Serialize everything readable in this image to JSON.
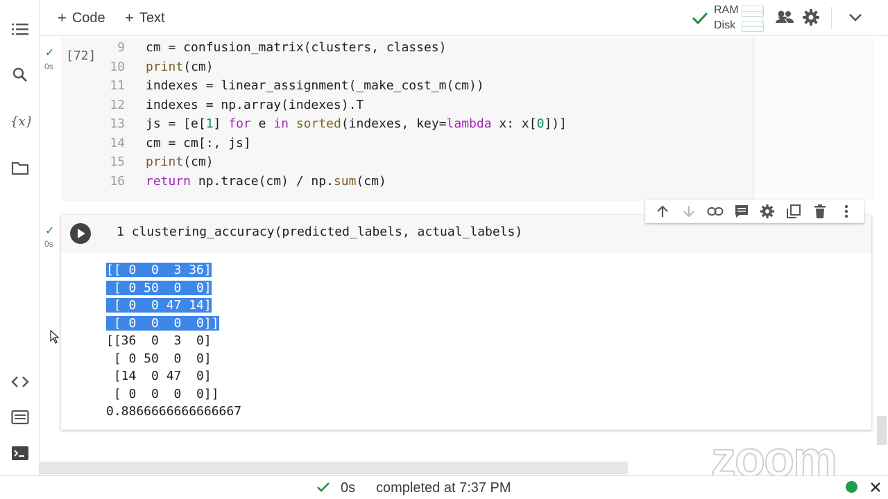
{
  "toolbar": {
    "code_label": "Code",
    "text_label": "Text",
    "ram_label": "RAM",
    "disk_label": "Disk"
  },
  "sidebar_icons": [
    "toc-icon",
    "search-icon",
    "variables-icon",
    "folder-icon",
    "code-snippets-icon",
    "command-palette-icon",
    "terminal-icon"
  ],
  "cell1": {
    "execution_count": "[72]",
    "run_time": "0s",
    "lines": [
      {
        "n": "9",
        "segments": [
          {
            "t": "cm = confusion_matrix(clusters, classes)",
            "c": ""
          }
        ]
      },
      {
        "n": "10",
        "segments": [
          {
            "t": "print",
            "c": "fn"
          },
          {
            "t": "(cm)",
            "c": ""
          }
        ]
      },
      {
        "n": "11",
        "segments": [
          {
            "t": "indexes = linear_assignment(_make_cost_m(cm))",
            "c": ""
          }
        ]
      },
      {
        "n": "12",
        "segments": [
          {
            "t": "indexes = np.array(indexes).T",
            "c": ""
          }
        ]
      },
      {
        "n": "13",
        "segments": [
          {
            "t": "js = [e[",
            "c": ""
          },
          {
            "t": "1",
            "c": "num"
          },
          {
            "t": "] ",
            "c": ""
          },
          {
            "t": "for",
            "c": "kw"
          },
          {
            "t": " e ",
            "c": ""
          },
          {
            "t": "in",
            "c": "kw"
          },
          {
            "t": " ",
            "c": ""
          },
          {
            "t": "sorted",
            "c": "fn"
          },
          {
            "t": "(indexes, key=",
            "c": ""
          },
          {
            "t": "lambda",
            "c": "kw"
          },
          {
            "t": " x: x[",
            "c": ""
          },
          {
            "t": "0",
            "c": "num"
          },
          {
            "t": "])]",
            "c": ""
          }
        ]
      },
      {
        "n": "14",
        "segments": [
          {
            "t": "cm = cm[:, js]",
            "c": ""
          }
        ]
      },
      {
        "n": "15",
        "segments": [
          {
            "t": "print",
            "c": "fn"
          },
          {
            "t": "(cm)",
            "c": ""
          }
        ]
      },
      {
        "n": "16",
        "segments": [
          {
            "t": "return",
            "c": "kw"
          },
          {
            "t": " np.trace(cm) / np.",
            "c": ""
          },
          {
            "t": "sum",
            "c": "fn"
          },
          {
            "t": "(cm)",
            "c": ""
          }
        ]
      }
    ]
  },
  "cell2": {
    "run_time": "0s",
    "line_number": "1",
    "code": "clustering_accuracy(predicted_labels, actual_labels)",
    "output_selected": [
      "[[ 0  0  3 36]",
      " [ 0 50  0  0]",
      " [ 0  0 47 14]",
      " [ 0  0  0  0]]"
    ],
    "output_plain": [
      "[[36  0  3  0]",
      " [ 0 50  0  0]",
      " [14  0 47  0]",
      " [ 0  0  0  0]]",
      "0.8866666666666667"
    ]
  },
  "cell_toolbar_icons": [
    "move-up-icon",
    "move-down-icon",
    "link-icon",
    "comment-icon",
    "settings-icon",
    "mirror-cell-icon",
    "delete-icon",
    "more-icon"
  ],
  "statusbar": {
    "duration": "0s",
    "completed_text": "completed at 7:37 PM"
  },
  "watermark": "zoom",
  "colors": {
    "selection": "#3d87e8",
    "keyword": "#9c27b0",
    "function": "#795e26",
    "number": "#098658",
    "success": "#1e8e3e"
  }
}
